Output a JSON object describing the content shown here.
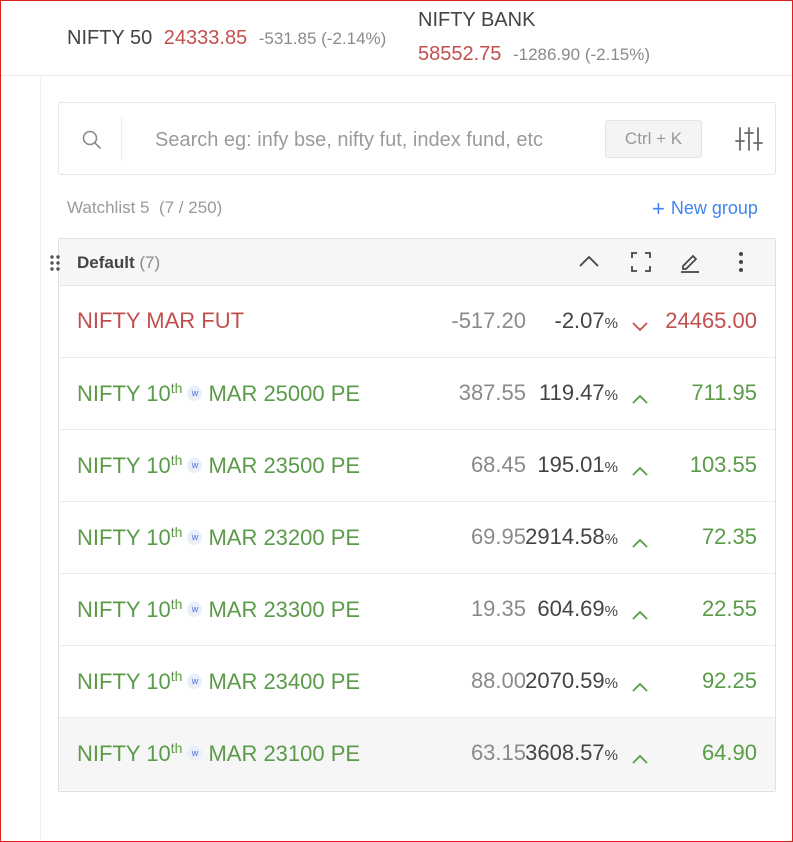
{
  "indices": [
    {
      "name": "NIFTY 50",
      "price": "24333.85",
      "change": "-531.85 (-2.14%)"
    },
    {
      "name": "NIFTY BANK",
      "price": "58552.75",
      "change": "-1286.90 (-2.15%)"
    }
  ],
  "search": {
    "placeholder": "Search eg: infy bse, nifty fut, index fund, etc",
    "shortcut": "Ctrl + K"
  },
  "watchlist": {
    "name": "Watchlist 5",
    "count": "(7 / 250)",
    "new_group_label": "New group"
  },
  "group": {
    "title": "Default",
    "count": "(7)"
  },
  "colors": {
    "down": "#c0504d",
    "up": "#5a9b47",
    "accent": "#4184f3"
  },
  "rows": [
    {
      "name": "NIFTY MAR FUT",
      "change": "-517.20",
      "pct": "-2.07",
      "ltp": "24465.00",
      "dir": "down"
    },
    {
      "name_prefix": "NIFTY 10",
      "sup": "th",
      "badge": "w",
      "name_suffix": "MAR 25000 PE",
      "change": "387.55",
      "pct": "119.47",
      "ltp": "711.95",
      "dir": "up"
    },
    {
      "name_prefix": "NIFTY 10",
      "sup": "th",
      "badge": "w",
      "name_suffix": "MAR 23500 PE",
      "change": "68.45",
      "pct": "195.01",
      "ltp": "103.55",
      "dir": "up"
    },
    {
      "name_prefix": "NIFTY 10",
      "sup": "th",
      "badge": "w",
      "name_suffix": "MAR 23200 PE",
      "change": "69.95",
      "pct": "2914.58",
      "ltp": "72.35",
      "dir": "up"
    },
    {
      "name_prefix": "NIFTY 10",
      "sup": "th",
      "badge": "w",
      "name_suffix": "MAR 23300 PE",
      "change": "19.35",
      "pct": "604.69",
      "ltp": "22.55",
      "dir": "up"
    },
    {
      "name_prefix": "NIFTY 10",
      "sup": "th",
      "badge": "w",
      "name_suffix": "MAR 23400 PE",
      "change": "88.00",
      "pct": "2070.59",
      "ltp": "92.25",
      "dir": "up"
    },
    {
      "name_prefix": "NIFTY 10",
      "sup": "th",
      "badge": "w",
      "name_suffix": "MAR 23100 PE",
      "change": "63.15",
      "pct": "3608.57",
      "ltp": "64.90",
      "dir": "up"
    }
  ],
  "pct_symbol": "%",
  "icons": [
    "search-icon",
    "filter-icon",
    "drag-handle-icon",
    "chevron-up-icon",
    "expand-icon",
    "edit-icon",
    "more-vertical-icon",
    "arrow-up-icon",
    "arrow-down-icon",
    "plus-icon"
  ]
}
